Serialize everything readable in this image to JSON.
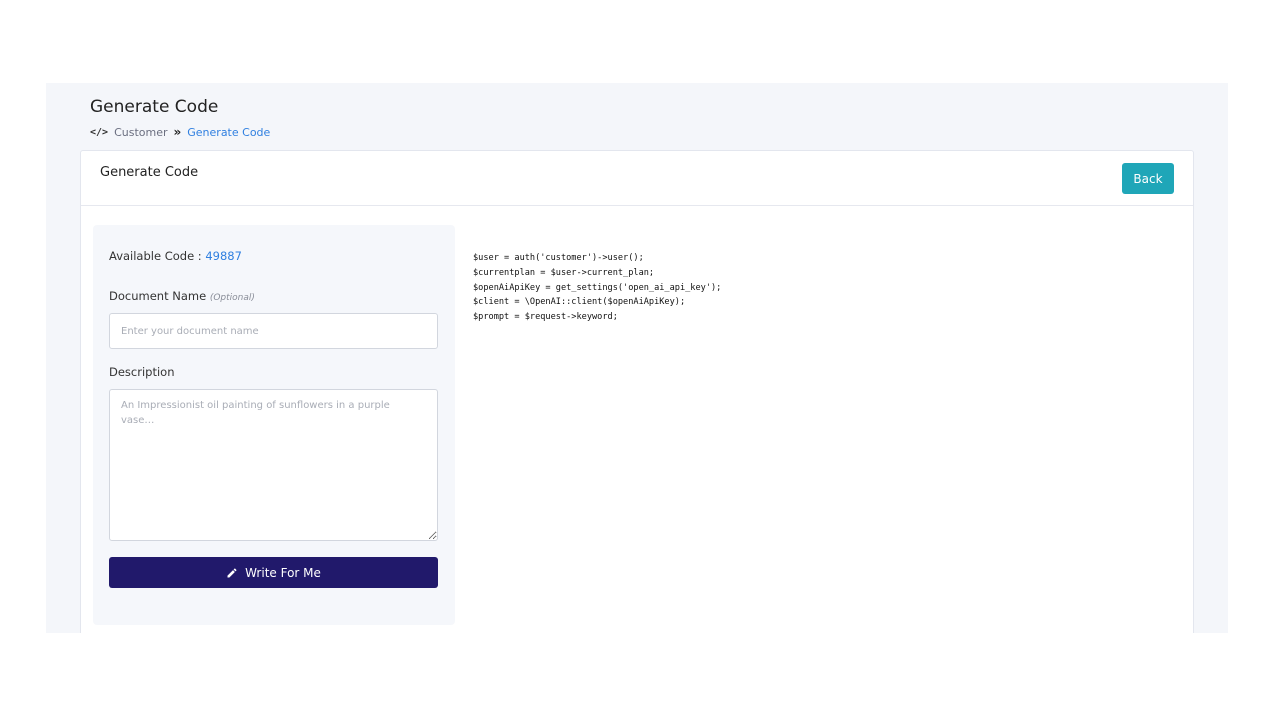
{
  "header": {
    "page_title": "Generate Code",
    "breadcrumb": {
      "icon": "code-icon",
      "parent": "Customer",
      "separator": "»",
      "current": "Generate Code"
    }
  },
  "card": {
    "title": "Generate Code",
    "back_label": "Back"
  },
  "form": {
    "available_label": "Available Code :",
    "available_count": "49887",
    "document_name_label": "Document Name",
    "document_name_optional": "(Optional)",
    "document_name_placeholder": "Enter your document name",
    "document_name_value": "",
    "description_label": "Description",
    "description_placeholder": "An Impressionist oil painting of sunflowers in a purple vase…",
    "description_value": "",
    "write_button_label": "Write For Me",
    "write_button_icon": "pencil-icon"
  },
  "code_output": {
    "lines": [
      "$user = auth('customer')->user();",
      "$currentplan = $user->current_plan;",
      "$openAiApiKey = get_settings('open_ai_api_key');",
      "$client = \\OpenAI::client($openAiApiKey);",
      "$prompt = $request->keyword;"
    ]
  },
  "colors": {
    "accent": "#2f7fe0",
    "back_button": "#1fa6b8",
    "primary_button": "#21196b",
    "page_background": "#f4f6fa"
  }
}
